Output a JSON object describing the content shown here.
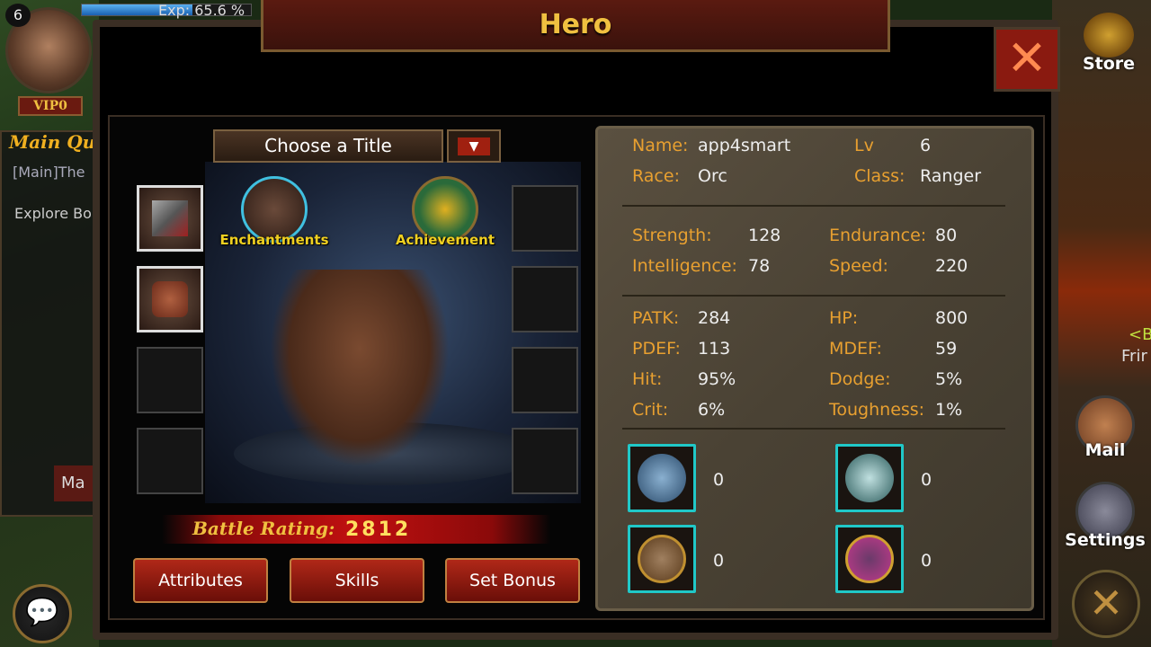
{
  "player": {
    "level": "6",
    "vip": "VIP0",
    "exp_label": "Exp: 65.6 %",
    "exp_percent": 65.6
  },
  "quest": {
    "title": "Main Qu",
    "line1": "[Main]The",
    "line2": "Explore Bo",
    "button": "Ma"
  },
  "window": {
    "title": "Hero",
    "close_icon": "close-x-icon"
  },
  "title_selector": {
    "value": "Choose a Title",
    "dropdown_icon": "▼"
  },
  "shortcuts": {
    "enchantments": "Enchantments",
    "achievement": "Achievement"
  },
  "battle_rating": {
    "label": "Battle Rating:",
    "value": "2812"
  },
  "tabs": [
    "Attributes",
    "Skills",
    "Set Bonus"
  ],
  "info": {
    "name_label": "Name:",
    "name": "app4smart",
    "lv_label": "Lv",
    "lv": "6",
    "race_label": "Race:",
    "race": "Orc",
    "class_label": "Class:",
    "class": "Ranger"
  },
  "base_stats": [
    {
      "label": "Strength:",
      "value": "128"
    },
    {
      "label": "Endurance:",
      "value": "80"
    },
    {
      "label": "Intelligence:",
      "value": "78"
    },
    {
      "label": "Speed:",
      "value": "220"
    }
  ],
  "combat_stats": [
    {
      "label": "PATK:",
      "value": "284"
    },
    {
      "label": "HP:",
      "value": "800"
    },
    {
      "label": "PDEF:",
      "value": "113"
    },
    {
      "label": "MDEF:",
      "value": "59"
    },
    {
      "label": "Hit:",
      "value": "95%"
    },
    {
      "label": "Dodge:",
      "value": "5%"
    },
    {
      "label": "Crit:",
      "value": "6%"
    },
    {
      "label": "Toughness:",
      "value": "1%"
    }
  ],
  "emblems": [
    {
      "icon": "shield-sword-icon",
      "count": "0"
    },
    {
      "icon": "skull-shield-icon",
      "count": "0"
    },
    {
      "icon": "lion-medal-icon",
      "count": "0"
    },
    {
      "icon": "dragon-shield-icon",
      "count": "0"
    }
  ],
  "side": {
    "store": "Store",
    "mail": "Mail",
    "settings": "Settings",
    "notice1": "<B",
    "notice2": "Frir"
  },
  "colors": {
    "label": "#e8a030",
    "accent": "#20c8c8",
    "title": "#f0c040"
  }
}
